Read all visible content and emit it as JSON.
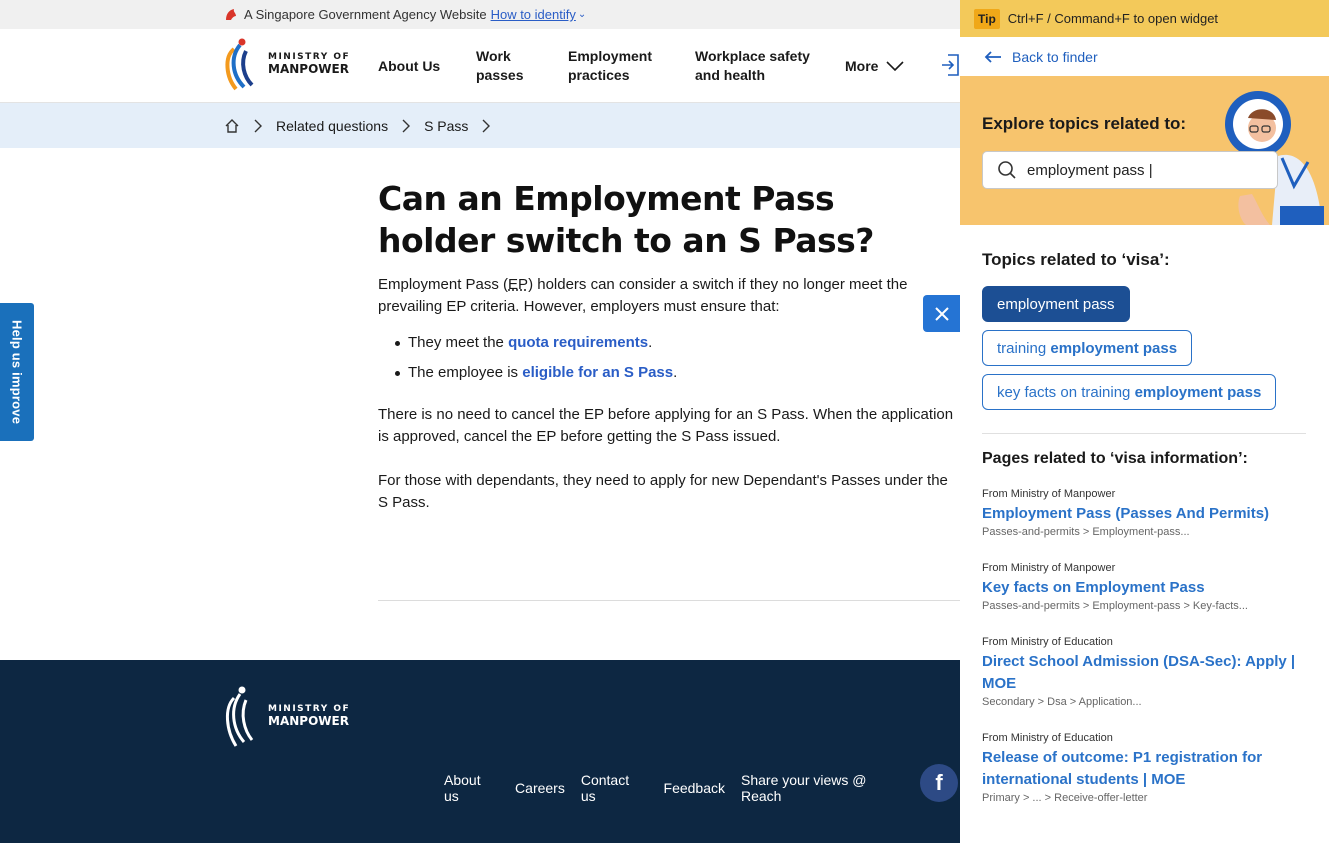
{
  "masthead": {
    "text": "A Singapore Government Agency Website",
    "link": "How to identify"
  },
  "logo": {
    "line1": "MINISTRY OF",
    "line2": "MANPOWER"
  },
  "nav": {
    "about": "About Us",
    "work_1": "Work",
    "work_2": "passes",
    "emp_1": "Employment",
    "emp_2": "practices",
    "wsh_1": "Workplace safety",
    "wsh_2": "and health",
    "more": "More"
  },
  "breadcrumb": {
    "item1": "Related questions",
    "item2": "S Pass"
  },
  "article": {
    "title": "Can an Employment Pass holder switch to an S Pass?",
    "p1_a": "Employment Pass (",
    "p1_abbr": "EP",
    "p1_b": ") holders can consider a switch if they no longer meet the prevailing EP criteria. However, employers must ensure that:",
    "b1_pre": "They meet the ",
    "b1_link": "quota requirements",
    "b1_post": ".",
    "b2_pre": "The employee is ",
    "b2_link": "eligible for an S Pass",
    "b2_post": ".",
    "p2": "There is no need to cancel the EP before applying for an S Pass. When the application is approved, cancel the EP before getting the S Pass issued.",
    "p3": "For those with dependants, they need to apply for new Dependant's Passes under the S Pass."
  },
  "help_tab": "Help us improve",
  "footer": {
    "links": [
      "About us",
      "Careers",
      "Contact us",
      "Feedback",
      "Share your views @ Reach"
    ],
    "facebook": "f"
  },
  "widget": {
    "tip_badge": "Tip",
    "tip_text": "Ctrl+F / Command+F to open widget",
    "back": "Back to finder",
    "explore_title": "Explore topics related to:",
    "search_value": "employment pass |",
    "topics_title": "Topics related to ‘visa’:",
    "chip1": "employment pass",
    "chip2_pre": "training ",
    "chip2_bold": "employment pass",
    "chip3_pre": "key facts on training ",
    "chip3_bold": "employment pass",
    "pages_title": "Pages related to ‘visa information’:",
    "results": [
      {
        "source": "From Ministry of Manpower",
        "title": "Employment Pass (Passes And Permits)",
        "path": "Passes-and-permits > Employment-pass..."
      },
      {
        "source": "From Ministry of Manpower",
        "title": "Key facts on Employment Pass",
        "path": "Passes-and-permits > Employment-pass > Key-facts..."
      },
      {
        "source": "From Ministry of Education",
        "title": "Direct School Admission (DSA-Sec): Apply | MOE",
        "path": "Secondary > Dsa > Application..."
      },
      {
        "source": "From Ministry of Education",
        "title": "Release of outcome: P1 registration for international students | MOE",
        "path": "Primary > ... > Receive-offer-letter"
      }
    ]
  },
  "colors": {
    "primary_blue": "#2a72c8",
    "chip_active": "#1c4f94",
    "footer_bg": "#0d2742",
    "tip_bg": "#f3c95a",
    "explore_bg": "#f7c46d",
    "crumb_bg": "#e4eef9"
  },
  "icons": [
    "lion-icon",
    "chevron-down-icon",
    "login-icon",
    "home-icon",
    "chevron-right-icon",
    "close-icon",
    "external-link-icon",
    "facebook-icon",
    "arrow-left-icon",
    "search-icon",
    "mascot-icon"
  ]
}
